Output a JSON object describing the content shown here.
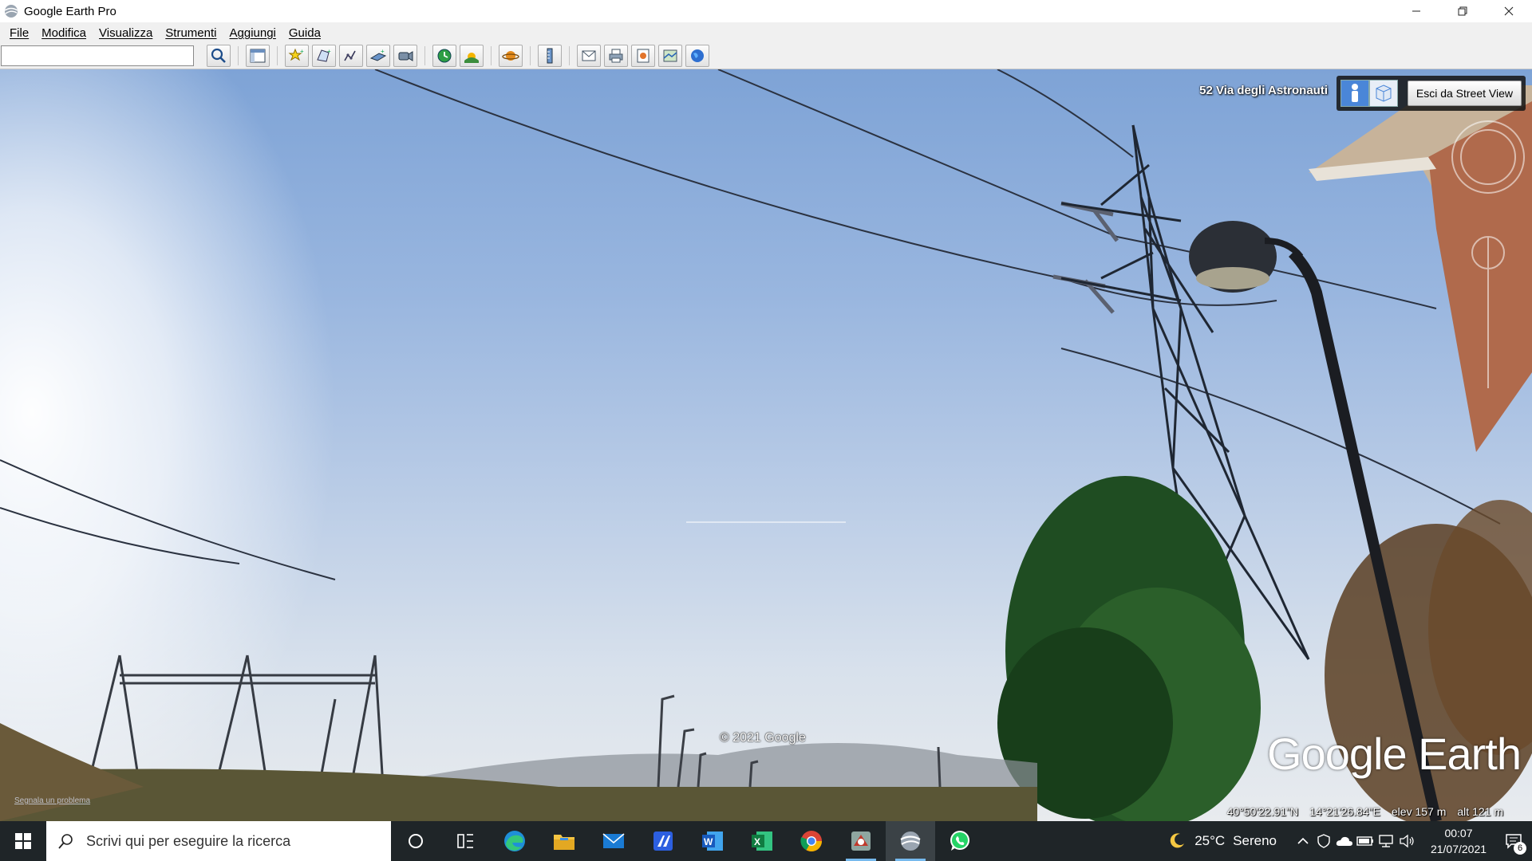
{
  "window": {
    "title": "Google Earth Pro",
    "icon": "google-earth-icon",
    "controls": [
      "minimize-icon",
      "restore-icon",
      "close-icon"
    ]
  },
  "menu": {
    "items": [
      "File",
      "Modifica",
      "Visualizza",
      "Strumenti",
      "Aggiungi",
      "Guida"
    ]
  },
  "toolbar": {
    "search_value": "",
    "buttons": [
      "search-icon",
      "sidebar-toggle-icon",
      "placemark-icon",
      "polygon-icon",
      "path-icon",
      "image-overlay-icon",
      "record-tour-icon",
      "historical-imagery-icon",
      "sunlight-icon",
      "planets-icon",
      "ruler-icon",
      "email-icon",
      "print-icon",
      "save-image-icon",
      "view-in-maps-icon",
      "earth-icon"
    ]
  },
  "streetview": {
    "address": "52 Via degli Astronauti",
    "exit_label": "Esci da Street View",
    "copyright": "© 2021 Google",
    "logo": "Google Earth",
    "report_link": "Segnala un problema"
  },
  "status": {
    "lat": "40°50'22.91\"N",
    "lon": "14°21'26.84\"E",
    "elev_label": "elev",
    "elev_value": "157 m",
    "alt_label": "alt",
    "alt_value": "121 m"
  },
  "taskbar": {
    "search_placeholder": "Scrivi qui per eseguire la ricerca",
    "apps": [
      "cortana-icon",
      "task-view-icon",
      "edge-icon",
      "file-explorer-icon",
      "mail-icon",
      "app-icon",
      "word-icon",
      "excel-icon",
      "chrome-icon",
      "app-icon",
      "google-earth-icon",
      "whatsapp-icon"
    ],
    "weather_temp": "25°C",
    "weather_condition": "Sereno",
    "time": "00:07",
    "date": "21/07/2021",
    "notifications": "6"
  },
  "colors": {
    "taskbar": "#1f2528",
    "sky_top": "#7ea3d6",
    "accent": "#76b9ed"
  }
}
